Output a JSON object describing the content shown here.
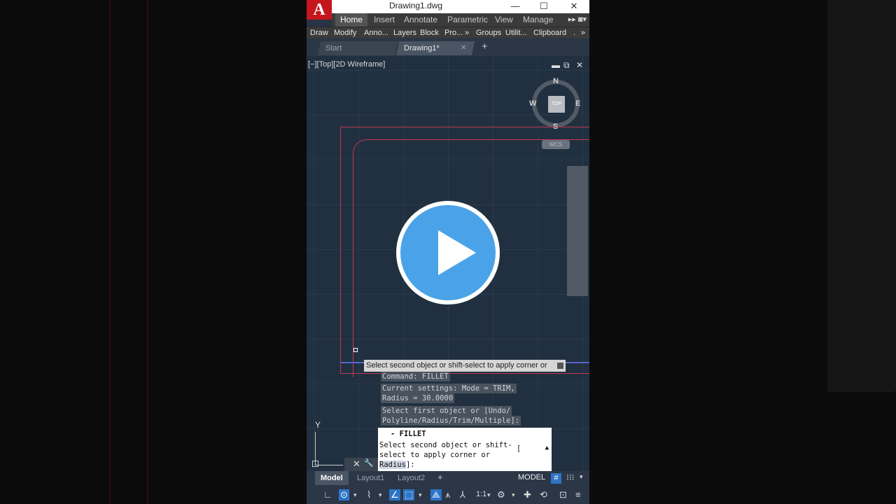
{
  "window": {
    "title": "Drawing1.dwg",
    "app_icon": "autocad-logo",
    "logo_letter": "A",
    "controls": {
      "minimize": "—",
      "maximize": "☐",
      "close": "✕"
    }
  },
  "ribbon": {
    "tabs": [
      {
        "label": "Home",
        "active": true
      },
      {
        "label": "Insert"
      },
      {
        "label": "Annotate"
      },
      {
        "label": "Parametric"
      },
      {
        "label": "View"
      },
      {
        "label": "Manage"
      }
    ],
    "more_tabs": "▸▸ ◙▾",
    "panels": [
      "Draw",
      "Modify",
      "Anno...",
      "Layers",
      "Block",
      "Pro...",
      "Groups",
      "Utilit...",
      "Clipboard"
    ],
    "panel_more": "»",
    "panel_end": "."
  },
  "file_tabs": {
    "start": "Start",
    "drawing": "Drawing1*",
    "close_icon": "✕",
    "new_tab": "+"
  },
  "viewport": {
    "label": "[−][Top][2D Wireframe]",
    "controls": {
      "minimize": "▬",
      "restore": "⧉",
      "close": "✕"
    },
    "viewcube": {
      "top": "TOP",
      "n": "N",
      "s": "S",
      "e": "E",
      "w": "W"
    },
    "wcs": "WCS"
  },
  "tooltip": {
    "text": "Select second object or shift-select to apply corner or"
  },
  "command_history": {
    "line1": "Command:  FILLET",
    "line2a": "Current settings: Mode = TRIM,",
    "line2b": "Radius = 30.0000",
    "line3a": "Select first object or [Undo/",
    "line3b": "Polyline/Radius/Trim/Multiple]:"
  },
  "command_line": {
    "name": "- FILLET",
    "prompt_a": "Select second object or shift-",
    "prompt_b": "select to apply corner or",
    "option": "Radius",
    "prompt_end": "]:",
    "scroll": "▲",
    "close": "✕",
    "customize": "🔧",
    "cursor": "["
  },
  "ucs": {
    "y": "Y"
  },
  "layout_tabs": {
    "model": "Model",
    "layout1": "Layout1",
    "layout2": "Layout2",
    "add": "+"
  },
  "status": {
    "mode": "MODEL",
    "grid": "#",
    "snap": "⁝⁝⁝",
    "caret": "▾",
    "scale": "1:1",
    "icons": [
      "∟",
      "⊙",
      "⌇",
      "∠",
      "⬚",
      "⟁",
      "⩚",
      "⅄",
      "⚙",
      "✚",
      "⟲",
      "⊡",
      "≡"
    ]
  },
  "overlay": {
    "play_icon": "play-icon"
  }
}
